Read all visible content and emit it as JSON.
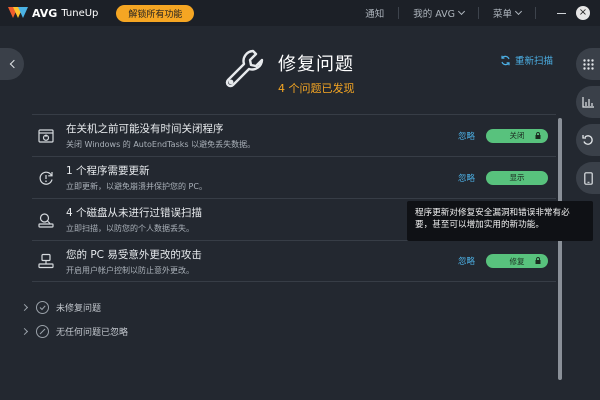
{
  "app": {
    "brand": "AVG",
    "product": "TuneUp",
    "unlock_label": "解锁所有功能"
  },
  "top_nav": {
    "notifications": "通知",
    "my_avg": "我的 AVG",
    "menu": "菜单"
  },
  "header": {
    "title": "修复问题",
    "subtitle": "4 个问题已发现",
    "rescan": "重新扫描"
  },
  "issues": [
    {
      "title": "在关机之前可能没有时间关闭程序",
      "desc": "关闭 Windows 的 AutoEndTasks 以避免丢失数据。",
      "ignore": "忽略",
      "action": "关闭",
      "locked": true,
      "icon": "shutdown-icon"
    },
    {
      "title": "1 个程序需要更新",
      "desc": "立即更新，以避免崩溃并保护您的 PC。",
      "ignore": "忽略",
      "action": "显示",
      "locked": false,
      "icon": "update-icon"
    },
    {
      "title": "4 个磁盘从未进行过错误扫描",
      "desc": "立即扫描，以防您的个人数据丢失。",
      "ignore": "",
      "action": "",
      "locked": false,
      "icon": "disk-scan-icon"
    },
    {
      "title": "您的 PC 易受意外更改的攻击",
      "desc": "开启用户帐户控制以防止意外更改。",
      "ignore": "忽略",
      "action": "修复",
      "locked": true,
      "icon": "uac-icon"
    }
  ],
  "sections": {
    "unfixed": "未修复问题",
    "ignored": "无任何问题已忽略"
  },
  "tooltip": {
    "text": "程序更新对修复安全漏洞和错误非常有必要，甚至可以增加实用的新功能。"
  },
  "colors": {
    "accent_orange": "#f5a623",
    "link_blue": "#4cb0e5",
    "action_green": "#58c27d",
    "background": "#232830"
  }
}
